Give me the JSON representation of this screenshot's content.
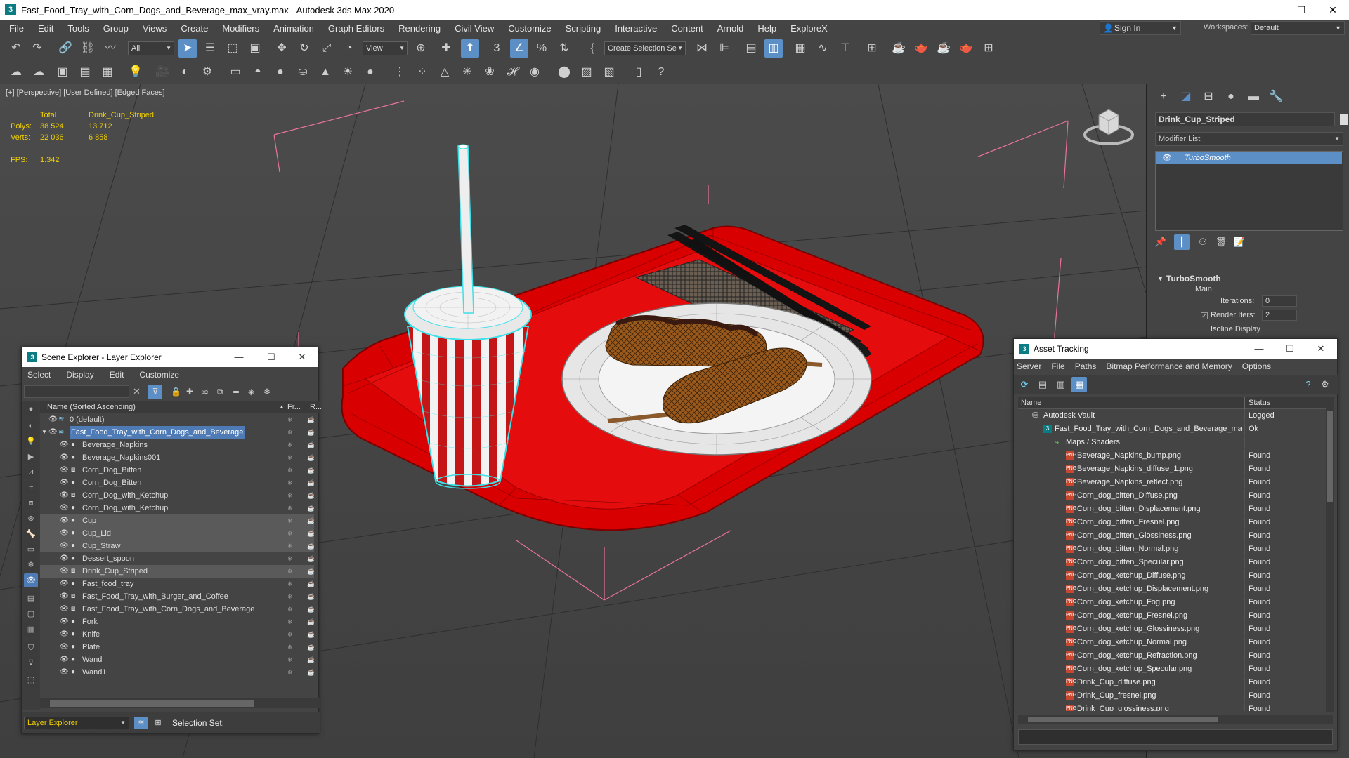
{
  "titlebar": {
    "title": "Fast_Food_Tray_with_Corn_Dogs_and_Beverage_max_vray.max - Autodesk 3ds Max 2020",
    "minimize": "—",
    "maximize": "☐",
    "close": "✕"
  },
  "menu": {
    "items": [
      "File",
      "Edit",
      "Tools",
      "Group",
      "Views",
      "Create",
      "Modifiers",
      "Animation",
      "Graph Editors",
      "Rendering",
      "Civil View",
      "Customize",
      "Scripting",
      "Interactive",
      "Content",
      "Arnold",
      "Help",
      "ExploreX"
    ]
  },
  "account": {
    "sign_in": "Sign In",
    "workspaces_label": "Workspaces:",
    "workspace_value": "Default"
  },
  "toolbar": {
    "filter_value": "All",
    "ref_coord_value": "View",
    "selection_set_placeholder": "Create Selection Se"
  },
  "viewport": {
    "label": "[+] [Perspective] [User Defined] [Edged Faces]",
    "stats": {
      "total_label": "Total",
      "object_label": "Drink_Cup_Striped",
      "polys_label": "Polys:",
      "polys_total": "38 524",
      "polys_obj": "13 712",
      "verts_label": "Verts:",
      "verts_total": "22 036",
      "verts_obj": "6 858",
      "fps_label": "FPS:",
      "fps_value": "1.342"
    }
  },
  "command_panel": {
    "object_name": "Drink_Cup_Striped",
    "modifier_list_label": "Modifier List",
    "stack_item": "TurboSmooth",
    "rollout_title": "TurboSmooth",
    "main_label": "Main",
    "iterations_label": "Iterations:",
    "iterations_value": "0",
    "render_iters_label": "Render Iters:",
    "render_iters_value": "2",
    "isoline_label": "Isoline Display"
  },
  "scene_explorer": {
    "title": "Scene Explorer - Layer Explorer",
    "menu": [
      "Select",
      "Display",
      "Edit",
      "Customize"
    ],
    "column_name": "Name (Sorted Ascending)",
    "column_fr": "Fr...",
    "column_r": "R...",
    "rows": [
      {
        "name": "0 (default)",
        "indent": 0,
        "kind": "layer",
        "selected": false
      },
      {
        "name": "Fast_Food_Tray_with_Corn_Dogs_and_Beverage",
        "indent": 0,
        "kind": "layer",
        "selected": false,
        "highlight": true
      },
      {
        "name": "Beverage_Napkins",
        "indent": 1,
        "kind": "obj",
        "selected": false
      },
      {
        "name": "Beverage_Napkins001",
        "indent": 1,
        "kind": "obj",
        "selected": false
      },
      {
        "name": "Corn_Dog_Bitten",
        "indent": 1,
        "kind": "grp",
        "selected": false
      },
      {
        "name": "Corn_Dog_Bitten",
        "indent": 1,
        "kind": "obj",
        "selected": false
      },
      {
        "name": "Corn_Dog_with_Ketchup",
        "indent": 1,
        "kind": "grp",
        "selected": false
      },
      {
        "name": "Corn_Dog_with_Ketchup",
        "indent": 1,
        "kind": "obj",
        "selected": false
      },
      {
        "name": "Cup",
        "indent": 1,
        "kind": "obj",
        "selected": true
      },
      {
        "name": "Cup_Lid",
        "indent": 1,
        "kind": "obj",
        "selected": true
      },
      {
        "name": "Cup_Straw",
        "indent": 1,
        "kind": "obj",
        "selected": true
      },
      {
        "name": "Dessert_spoon",
        "indent": 1,
        "kind": "obj",
        "selected": false
      },
      {
        "name": "Drink_Cup_Striped",
        "indent": 1,
        "kind": "grp",
        "selected": true
      },
      {
        "name": "Fast_food_tray",
        "indent": 1,
        "kind": "obj",
        "selected": false
      },
      {
        "name": "Fast_Food_Tray_with_Burger_and_Coffee",
        "indent": 1,
        "kind": "grp",
        "selected": false
      },
      {
        "name": "Fast_Food_Tray_with_Corn_Dogs_and_Beverage",
        "indent": 1,
        "kind": "grp",
        "selected": false
      },
      {
        "name": "Fork",
        "indent": 1,
        "kind": "obj",
        "selected": false
      },
      {
        "name": "Knife",
        "indent": 1,
        "kind": "obj",
        "selected": false
      },
      {
        "name": "Plate",
        "indent": 1,
        "kind": "obj",
        "selected": false
      },
      {
        "name": "Wand",
        "indent": 1,
        "kind": "obj",
        "selected": false
      },
      {
        "name": "Wand1",
        "indent": 1,
        "kind": "obj",
        "selected": false
      }
    ],
    "footer_explorer": "Layer Explorer",
    "footer_selection_set": "Selection Set:"
  },
  "asset_tracking": {
    "title": "Asset Tracking",
    "menu": [
      "Server",
      "File",
      "Paths",
      "Bitmap Performance and Memory",
      "Options"
    ],
    "col_name": "Name",
    "col_status": "Status",
    "rows": [
      {
        "name": "Autodesk Vault",
        "status": "Logged",
        "indent": 0,
        "kind": "vault"
      },
      {
        "name": "Fast_Food_Tray_with_Corn_Dogs_and_Beverage_max_vray.max",
        "status": "Ok",
        "indent": 1,
        "kind": "max"
      },
      {
        "name": "Maps / Shaders",
        "status": "",
        "indent": 2,
        "kind": "folder"
      },
      {
        "name": "Beverage_Napkins_bump.png",
        "status": "Found",
        "indent": 3,
        "kind": "png"
      },
      {
        "name": "Beverage_Napkins_diffuse_1.png",
        "status": "Found",
        "indent": 3,
        "kind": "png"
      },
      {
        "name": "Beverage_Napkins_reflect.png",
        "status": "Found",
        "indent": 3,
        "kind": "png"
      },
      {
        "name": "Corn_dog_bitten_Diffuse.png",
        "status": "Found",
        "indent": 3,
        "kind": "png"
      },
      {
        "name": "Corn_dog_bitten_Displacement.png",
        "status": "Found",
        "indent": 3,
        "kind": "png"
      },
      {
        "name": "Corn_dog_bitten_Fresnel.png",
        "status": "Found",
        "indent": 3,
        "kind": "png"
      },
      {
        "name": "Corn_dog_bitten_Glossiness.png",
        "status": "Found",
        "indent": 3,
        "kind": "png"
      },
      {
        "name": "Corn_dog_bitten_Normal.png",
        "status": "Found",
        "indent": 3,
        "kind": "png"
      },
      {
        "name": "Corn_dog_bitten_Specular.png",
        "status": "Found",
        "indent": 3,
        "kind": "png"
      },
      {
        "name": "Corn_dog_ketchup_Diffuse.png",
        "status": "Found",
        "indent": 3,
        "kind": "png"
      },
      {
        "name": "Corn_dog_ketchup_Displacement.png",
        "status": "Found",
        "indent": 3,
        "kind": "png"
      },
      {
        "name": "Corn_dog_ketchup_Fog.png",
        "status": "Found",
        "indent": 3,
        "kind": "png"
      },
      {
        "name": "Corn_dog_ketchup_Fresnel.png",
        "status": "Found",
        "indent": 3,
        "kind": "png"
      },
      {
        "name": "Corn_dog_ketchup_Glossiness.png",
        "status": "Found",
        "indent": 3,
        "kind": "png"
      },
      {
        "name": "Corn_dog_ketchup_Normal.png",
        "status": "Found",
        "indent": 3,
        "kind": "png"
      },
      {
        "name": "Corn_dog_ketchup_Refraction.png",
        "status": "Found",
        "indent": 3,
        "kind": "png"
      },
      {
        "name": "Corn_dog_ketchup_Specular.png",
        "status": "Found",
        "indent": 3,
        "kind": "png"
      },
      {
        "name": "Drink_Cup_diffuse.png",
        "status": "Found",
        "indent": 3,
        "kind": "png"
      },
      {
        "name": "Drink_Cup_fresnel.png",
        "status": "Found",
        "indent": 3,
        "kind": "png"
      },
      {
        "name": "Drink_Cup_glossiness.png",
        "status": "Found",
        "indent": 3,
        "kind": "png"
      }
    ]
  },
  "colors": {
    "accent": "#5d8fc7",
    "selected_row": "#5a5a5a",
    "stat_yellow": "#f0d000",
    "tray_red": "#d90000",
    "wire_cyan": "#3de0e8"
  }
}
